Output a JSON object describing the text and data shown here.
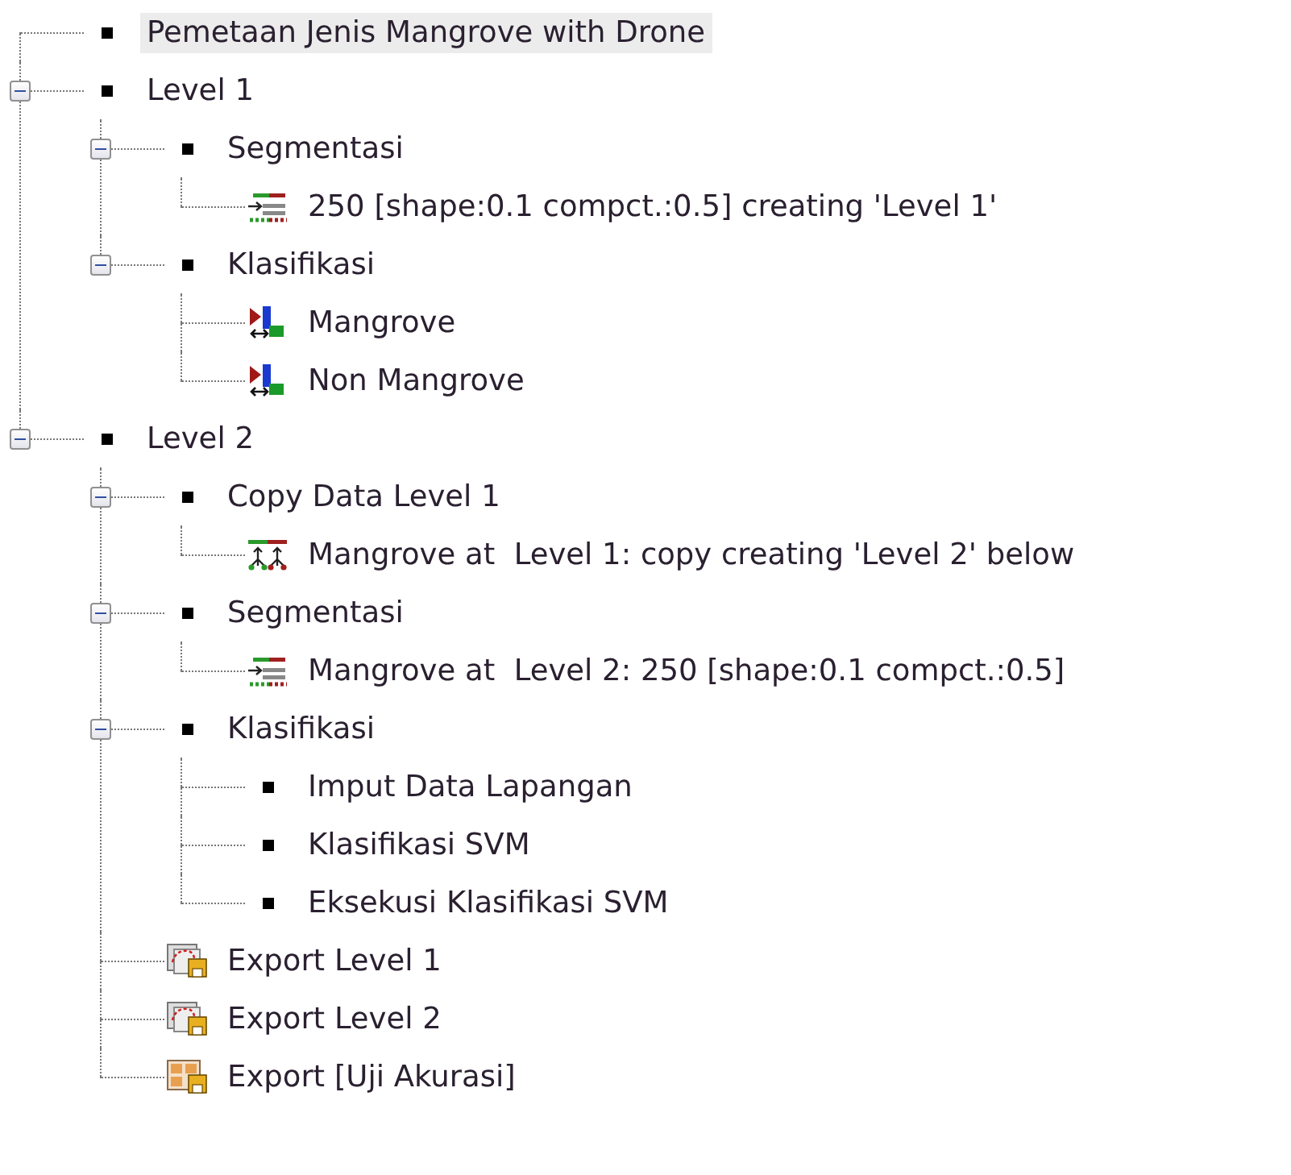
{
  "tree": [
    {
      "label": "Pemetaan Jenis Mangrove with Drone",
      "kind": "process",
      "selected": true
    },
    {
      "label": "Level 1",
      "kind": "process",
      "expanded": true,
      "selected": false,
      "children": [
        {
          "label": "Segmentasi",
          "kind": "process",
          "expanded": true,
          "selected": false,
          "children": [
            {
              "label": "250 [shape:0.1 compct.:0.5] creating 'Level 1'",
              "kind": "segmentation",
              "selected": false
            }
          ]
        },
        {
          "label": "Klasifikasi",
          "kind": "process",
          "expanded": true,
          "selected": false,
          "children": [
            {
              "label": "Mangrove",
              "kind": "classification",
              "selected": false
            },
            {
              "label": "Non Mangrove",
              "kind": "classification",
              "selected": false
            }
          ]
        }
      ]
    },
    {
      "label": "Level 2",
      "kind": "process",
      "expanded": true,
      "selected": false,
      "children": [
        {
          "label": "Copy Data Level 1",
          "kind": "process",
          "expanded": true,
          "selected": false,
          "children": [
            {
              "label": "Mangrove at  Level 1: copy creating 'Level 2' below",
              "kind": "copy",
              "selected": false
            }
          ]
        },
        {
          "label": "Segmentasi",
          "kind": "process",
          "expanded": true,
          "selected": false,
          "children": [
            {
              "label": "Mangrove at  Level 2: 250 [shape:0.1 compct.:0.5]",
              "kind": "segmentation",
              "selected": false
            }
          ]
        },
        {
          "label": "Klasifikasi",
          "kind": "process",
          "expanded": true,
          "selected": false,
          "children": [
            {
              "label": "Imput Data Lapangan",
              "kind": "process",
              "selected": false
            },
            {
              "label": "Klasifikasi SVM",
              "kind": "process",
              "selected": false
            },
            {
              "label": "Eksekusi Klasifikasi SVM",
              "kind": "process",
              "selected": false
            }
          ]
        },
        {
          "label": "Export Level 1",
          "kind": "export-map",
          "selected": false
        },
        {
          "label": "Export Level 2",
          "kind": "export-map",
          "selected": false
        },
        {
          "label": "Export [Uji Akurasi]",
          "kind": "export-table",
          "selected": false
        }
      ]
    }
  ]
}
